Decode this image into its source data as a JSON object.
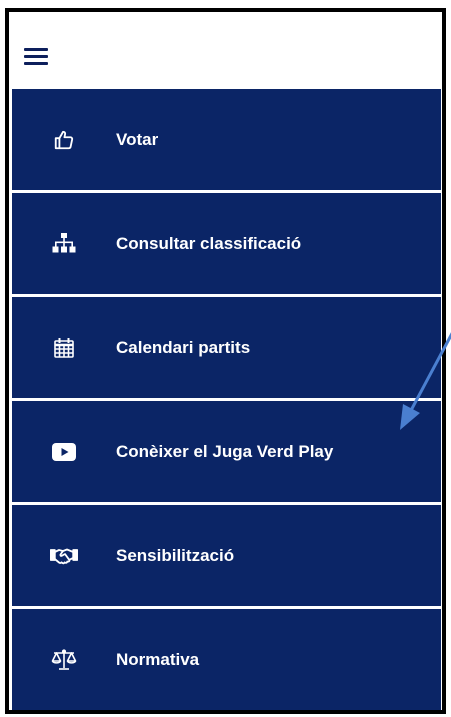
{
  "menu": {
    "items": [
      {
        "label": "Votar",
        "icon": "thumbs-up-icon"
      },
      {
        "label": "Consultar classificació",
        "icon": "hierarchy-icon"
      },
      {
        "label": "Calendari partits",
        "icon": "calendar-icon"
      },
      {
        "label": "Conèixer el Juga Verd Play",
        "icon": "youtube-play-icon"
      },
      {
        "label": "Sensibilització",
        "icon": "handshake-icon"
      },
      {
        "label": "Normativa",
        "icon": "scales-icon"
      }
    ]
  },
  "header": {
    "menu_icon": "hamburger-menu-icon"
  },
  "colors": {
    "menu_background": "#0b2566",
    "menu_text": "#ffffff",
    "annotation_arrow": "#4a7fd0"
  }
}
